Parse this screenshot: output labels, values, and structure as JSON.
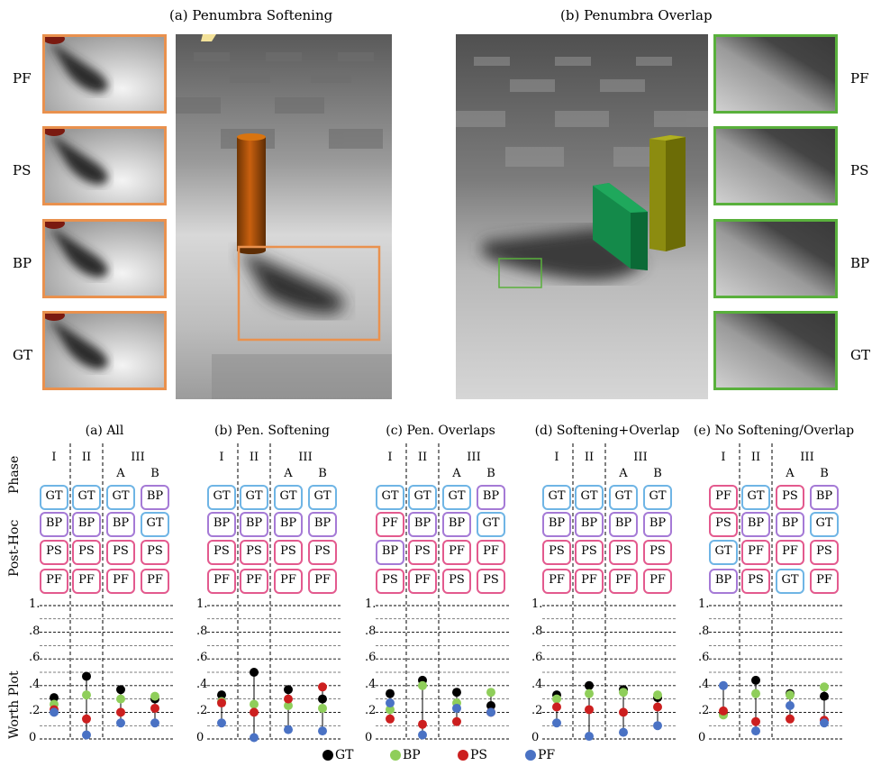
{
  "top": {
    "title_a": "(a) Penumbra Softening",
    "title_b": "(b) Penumbra Overlap",
    "left_labels": [
      "PF",
      "PS",
      "BP",
      "GT"
    ],
    "right_labels": [
      "PF",
      "PS",
      "BP",
      "GT"
    ],
    "colors": {
      "softening_border": "#e9914e",
      "overlap_border": "#59b03c"
    }
  },
  "bottom": {
    "row_labels": {
      "phase": "Phase",
      "posthoc": "Post-Hoc",
      "worth": "Worth Plot"
    },
    "phase_headers": [
      "I",
      "II",
      "III"
    ],
    "sub_headers": [
      "A",
      "B"
    ],
    "y_ticks": [
      "1.",
      ".8",
      ".6",
      ".4",
      ".2",
      "0"
    ],
    "panels": [
      {
        "title": "(a) All",
        "cols": [
          [
            "GT",
            "BP",
            "PS",
            "PF"
          ],
          [
            "GT",
            "BP",
            "PS",
            "PF"
          ],
          [
            "GT",
            "BP",
            "PS",
            "PF"
          ],
          [
            "BP",
            "GT",
            "PS",
            "PF"
          ]
        ]
      },
      {
        "title": "(b) Pen. Softening",
        "cols": [
          [
            "GT",
            "BP",
            "PS",
            "PF"
          ],
          [
            "GT",
            "BP",
            "PS",
            "PF"
          ],
          [
            "GT",
            "BP",
            "PS",
            "PF"
          ],
          [
            "GT",
            "BP",
            "PS",
            "PF"
          ]
        ]
      },
      {
        "title": "(c) Pen. Overlaps",
        "cols": [
          [
            "GT",
            "PF",
            "BP",
            "PS"
          ],
          [
            "GT",
            "BP",
            "PS",
            "PF"
          ],
          [
            "GT",
            "BP",
            "PF",
            "PS"
          ],
          [
            "BP",
            "GT",
            "PF",
            "PS"
          ]
        ]
      },
      {
        "title": "(d) Softening+Overlap",
        "cols": [
          [
            "GT",
            "BP",
            "PS",
            "PF"
          ],
          [
            "GT",
            "BP",
            "PS",
            "PF"
          ],
          [
            "GT",
            "BP",
            "PS",
            "PF"
          ],
          [
            "GT",
            "BP",
            "PS",
            "PF"
          ]
        ]
      },
      {
        "title": "(e) No Softening/Overlap",
        "cols": [
          [
            "PF",
            "PS",
            "GT",
            "BP"
          ],
          [
            "GT",
            "BP",
            "PF",
            "PS"
          ],
          [
            "PS",
            "BP",
            "PF",
            "GT"
          ],
          [
            "BP",
            "GT",
            "PS",
            "PF"
          ]
        ]
      }
    ]
  },
  "chart_data": {
    "type": "scatter",
    "ylim": [
      0,
      1
    ],
    "y_ticks": [
      0,
      0.2,
      0.4,
      0.6,
      0.8,
      1.0
    ],
    "legend": [
      "GT",
      "BP",
      "PS",
      "PF"
    ],
    "series_colors": {
      "GT": "#000000",
      "BP": "#8fce5a",
      "PS": "#cc1f1f",
      "PF": "#4a72c4"
    },
    "panels": [
      {
        "title": "(a) All",
        "columns": [
          "I",
          "II",
          "III-A",
          "III-B"
        ],
        "values": {
          "GT": [
            0.31,
            0.47,
            0.37,
            0.3
          ],
          "BP": [
            0.26,
            0.33,
            0.3,
            0.32
          ],
          "PS": [
            0.22,
            0.15,
            0.2,
            0.23
          ],
          "PF": [
            0.2,
            0.03,
            0.12,
            0.12
          ]
        }
      },
      {
        "title": "(b) Pen. Softening",
        "columns": [
          "I",
          "II",
          "III-A",
          "III-B"
        ],
        "values": {
          "GT": [
            0.33,
            0.5,
            0.37,
            0.3
          ],
          "BP": [
            0.28,
            0.26,
            0.25,
            0.23
          ],
          "PS": [
            0.27,
            0.2,
            0.3,
            0.39
          ],
          "PF": [
            0.12,
            0.01,
            0.07,
            0.06
          ]
        }
      },
      {
        "title": "(c) Pen. Overlaps",
        "columns": [
          "I",
          "II",
          "III-A",
          "III-B"
        ],
        "values": {
          "GT": [
            0.34,
            0.44,
            0.35,
            0.25
          ],
          "BP": [
            0.22,
            0.4,
            0.27,
            0.35
          ],
          "PS": [
            0.15,
            0.11,
            0.13,
            0.2
          ],
          "PF": [
            0.27,
            0.03,
            0.23,
            0.2
          ]
        }
      },
      {
        "title": "(d) Softening+Overlap",
        "columns": [
          "I",
          "II",
          "III-A",
          "III-B"
        ],
        "values": {
          "GT": [
            0.33,
            0.4,
            0.37,
            0.31
          ],
          "BP": [
            0.3,
            0.34,
            0.35,
            0.33
          ],
          "PS": [
            0.24,
            0.22,
            0.2,
            0.24
          ],
          "PF": [
            0.12,
            0.02,
            0.05,
            0.1
          ]
        }
      },
      {
        "title": "(e) No Softening/Overlap",
        "columns": [
          "I",
          "II",
          "III-A",
          "III-B"
        ],
        "values": {
          "GT": [
            0.19,
            0.44,
            0.34,
            0.32
          ],
          "BP": [
            0.18,
            0.34,
            0.33,
            0.39
          ],
          "PS": [
            0.21,
            0.13,
            0.15,
            0.14
          ],
          "PF": [
            0.4,
            0.06,
            0.25,
            0.12
          ]
        }
      }
    ]
  }
}
